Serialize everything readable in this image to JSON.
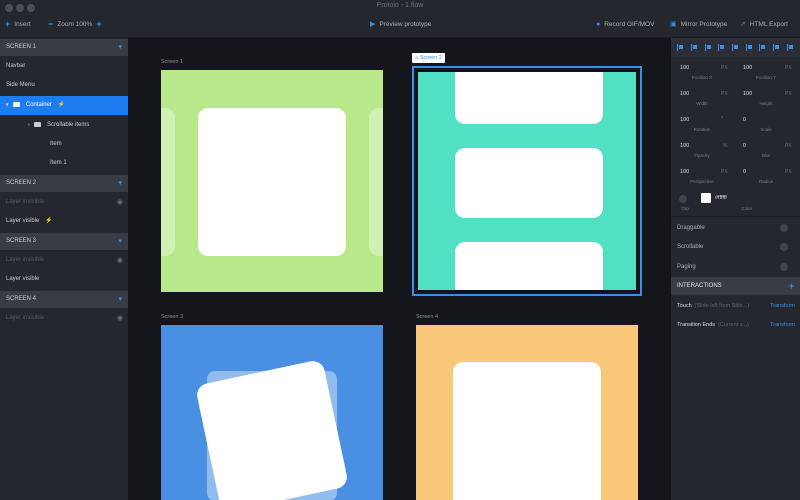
{
  "window": {
    "title": "Protoio - 1.flow"
  },
  "toolbar": {
    "insert": "Insert",
    "zoom": "Zoom 100%",
    "preview": "Preview prototype",
    "record": "Record GIF/MOV",
    "mirror": "Mirror Prototype",
    "export": "HTML Export"
  },
  "sidebar": {
    "screens": [
      {
        "title": "SCREEN 1"
      },
      {
        "title": "SCREEN 2"
      },
      {
        "title": "SCREEN 3"
      },
      {
        "title": "SCREEN 4"
      }
    ],
    "s1_items": [
      "Navbar",
      "Side Menu",
      "Container",
      "Scrollable items",
      "Item",
      "Item 1"
    ],
    "s2_items": [
      "Layer invisible",
      "Layer visible"
    ],
    "s3_items": [
      "Layer invisible",
      "Layer visible"
    ],
    "s4_items": [
      "Layer invisible"
    ]
  },
  "canvas": {
    "screens": [
      {
        "label": "Screen 1",
        "color": "#b9e88a"
      },
      {
        "label": "Screen 2",
        "color": "#52e0c4"
      },
      {
        "label": "Screen 3",
        "color": "#4a90e2"
      },
      {
        "label": "Screen 4",
        "color": "#f8c878"
      }
    ],
    "selection_color": "#3a8ee6"
  },
  "properties": {
    "position_x": {
      "value": "100",
      "unit": "PX",
      "label": "Position X"
    },
    "position_y": {
      "value": "100",
      "unit": "PX",
      "label": "Position Y"
    },
    "width": {
      "value": "100",
      "unit": "PX",
      "label": "Width"
    },
    "height": {
      "value": "100",
      "unit": "PX",
      "label": "Height"
    },
    "rotation": {
      "value": "100",
      "unit": "°",
      "label": "Rotation"
    },
    "scale": {
      "value": "0",
      "label": "Scale"
    },
    "opacity": {
      "value": "100",
      "unit": "%",
      "label": "Opacity"
    },
    "blur": {
      "value": "0",
      "unit": "PX",
      "label": "Blur"
    },
    "perspective": {
      "value": "100",
      "unit": "PX",
      "label": "Perspective"
    },
    "radius": {
      "value": "0",
      "unit": "PX",
      "label": "Radius"
    },
    "clip_label": "Clip",
    "color_value": "#ffffff",
    "color_label": "Color",
    "draggable": "Draggable",
    "scrollable": "Scrollable",
    "paging": "Paging"
  },
  "interactions": {
    "header": "INTERACTIONS",
    "rows": [
      {
        "event": "Touch",
        "hint": "(Slide left from Side...)",
        "action": "Transform"
      },
      {
        "event": "Transition Ends",
        "hint": "(Current s...)",
        "action": "Transform"
      }
    ]
  }
}
